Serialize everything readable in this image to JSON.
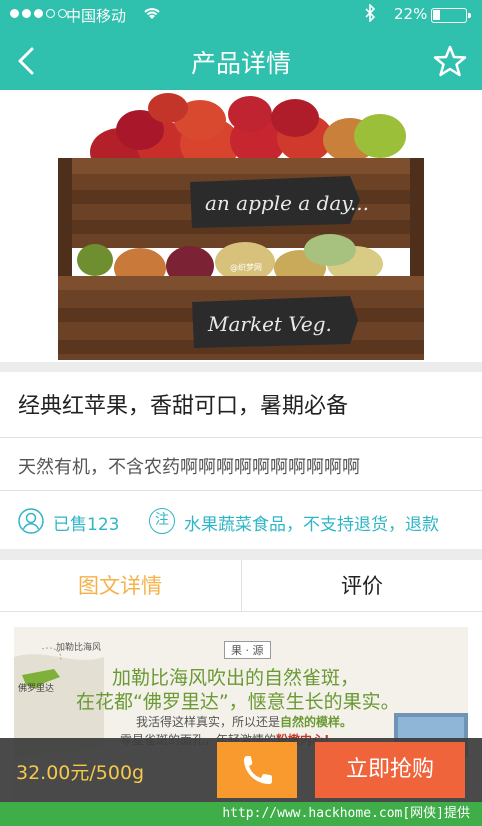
{
  "status_bar": {
    "carrier": "中国移动",
    "battery_percent": "22%",
    "battery_level": 0.22
  },
  "nav": {
    "title": "产品详情",
    "back_icon": "chevron-left-icon",
    "favorite_icon": "star-outline-icon"
  },
  "hero": {
    "chalk_top": "an apple a day...",
    "chalk_bottom": "Market Veg.",
    "watermark": "@织梦网"
  },
  "product": {
    "title": "经典红苹果，香甜可口，暑期必备",
    "subtitle": "天然有机，不含农药啊啊啊啊啊啊啊啊啊啊",
    "sold": "已售123",
    "notice_icon_text": "注",
    "notice": "水果蔬菜食品，不支持退货，退款"
  },
  "tabs": [
    {
      "label": "图文详情",
      "active": true
    },
    {
      "label": "评价",
      "active": false
    }
  ],
  "detail_image": {
    "map_label_1": "加勒比海风",
    "map_label_2": "佛罗里达",
    "tag": "果 · 源",
    "headline_1": "加勒比海风吹出的自然雀斑，",
    "headline_2": "在花都“佛罗里达”，惬意生长的果实。",
    "line_1_prefix": "我活得这样真实，所以还是",
    "line_1_emph": "自然的模样。",
    "line_2_prefix": "零星雀斑的面孔，年轻激情的",
    "line_2_emph": "粉嫩内心!"
  },
  "buy_bar": {
    "price": "32.00元/500g",
    "call_icon": "phone-icon",
    "buy_label": "立即抢购"
  },
  "footer_watermark": "http://www.hackhome.com[网侠]提供",
  "colors": {
    "brand": "#2fc0ae",
    "accent_orange": "#f89a2e",
    "buy_red": "#f0643c",
    "tab_active": "#f6b24a",
    "info_blue": "#2fb6c6"
  }
}
